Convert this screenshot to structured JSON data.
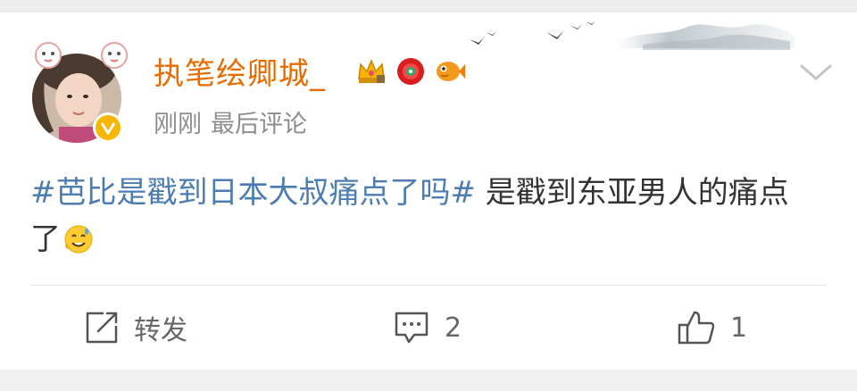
{
  "post": {
    "username": "执笔绘卿城_",
    "meta_time": "刚刚",
    "meta_action": "最后评论",
    "content": {
      "topic": "#芭比是戳到日本大叔痛点了吗#",
      "text": " 是戳到东亚男人的痛点了",
      "emoji": "smile-sweat-emoji"
    },
    "badges": [
      "crown-badge-icon",
      "red-flower-badge-icon",
      "fish-badge-icon"
    ]
  },
  "actions": {
    "repost_label": "转发",
    "comment_count": "2",
    "like_count": "1"
  },
  "colors": {
    "username": "#e86b00",
    "topic": "#4c7cb0",
    "text": "#333333",
    "meta": "#8d8d8d",
    "vbadge": "#f7b600"
  }
}
